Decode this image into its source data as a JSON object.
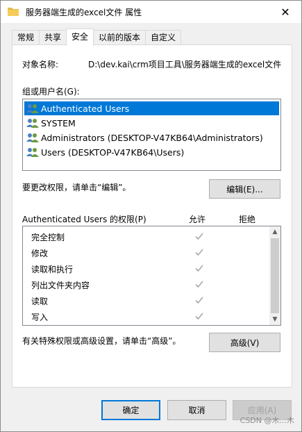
{
  "window": {
    "title": "服务器端生成的excel文件 属性",
    "close_symbol": "✕"
  },
  "tabs": [
    {
      "label": "常规"
    },
    {
      "label": "共享"
    },
    {
      "label": "安全"
    },
    {
      "label": "以前的版本"
    },
    {
      "label": "自定义"
    }
  ],
  "active_tab": "安全",
  "security": {
    "object_label": "对象名称:",
    "object_value": "D:\\dev.kai\\crm项目工具\\服务器端生成的excel文件",
    "group_label": "组或用户名(G):",
    "users": [
      {
        "name": "Authenticated Users",
        "icon": "users-group-icon",
        "selected": true
      },
      {
        "name": "SYSTEM",
        "icon": "users-group-icon",
        "selected": false
      },
      {
        "name": "Administrators (DESKTOP-V47KB64\\Administrators)",
        "icon": "users-group-icon",
        "selected": false
      },
      {
        "name": "Users (DESKTOP-V47KB64\\Users)",
        "icon": "users-group-icon",
        "selected": false
      }
    ],
    "edit_hint": "要更改权限，请单击“编辑”。",
    "edit_button": "编辑(E)...",
    "permissions_label": "Authenticated Users 的权限(P)",
    "allow_header": "允许",
    "deny_header": "拒绝",
    "permissions": [
      {
        "name": "完全控制",
        "allow": true,
        "deny": false
      },
      {
        "name": "修改",
        "allow": true,
        "deny": false
      },
      {
        "name": "读取和执行",
        "allow": true,
        "deny": false
      },
      {
        "name": "列出文件夹内容",
        "allow": true,
        "deny": false
      },
      {
        "name": "读取",
        "allow": true,
        "deny": false
      },
      {
        "name": "写入",
        "allow": true,
        "deny": false
      }
    ],
    "advanced_hint": "有关特殊权限或高级设置，请单击“高级”。",
    "advanced_button": "高级(V)"
  },
  "footer": {
    "ok": "确定",
    "cancel": "取消",
    "apply": "应用(A)"
  },
  "watermark": "CSDN @木...木",
  "colors": {
    "selection": "#0078d7",
    "check_gray": "#a8a8a8"
  }
}
